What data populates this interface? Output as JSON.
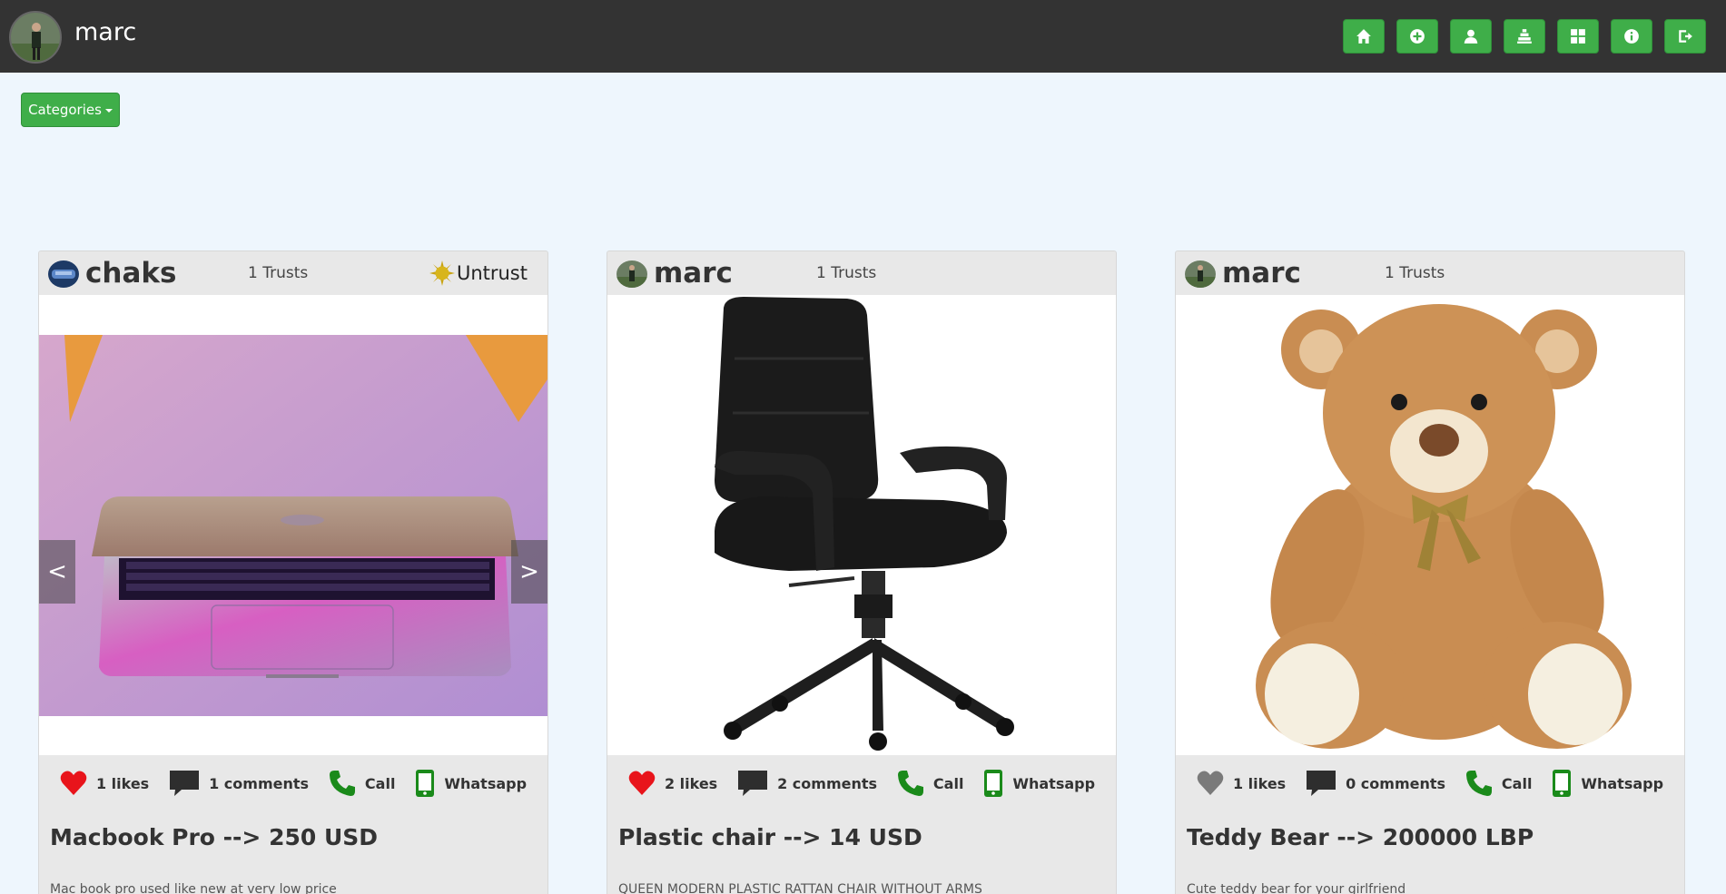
{
  "navbar": {
    "username": "marc",
    "buttons": [
      "home-icon",
      "plus-circle-icon",
      "user-icon",
      "tower-icon",
      "grid-icon",
      "info-icon",
      "logout-icon"
    ],
    "button_color": "#3fae49"
  },
  "categories": {
    "label": "Categories"
  },
  "cards": [
    {
      "owner": "chaks",
      "trusts": "1 Trusts",
      "trust_action": "Untrust",
      "likes": "1 likes",
      "comments": "1 comments",
      "call": "Call",
      "whatsapp": "Whatsapp",
      "liked": true,
      "title": "Macbook Pro --> 250 USD",
      "description": "Mac book pro used like new at very low price",
      "prev": "<",
      "next": ">"
    },
    {
      "owner": "marc",
      "trusts": "1 Trusts",
      "likes": "2 likes",
      "comments": "2 comments",
      "call": "Call",
      "whatsapp": "Whatsapp",
      "liked": true,
      "title": "Plastic chair --> 14 USD",
      "description": "QUEEN MODERN PLASTIC RATTAN CHAIR WITHOUT ARMS"
    },
    {
      "owner": "marc",
      "trusts": "1 Trusts",
      "likes": "1 likes",
      "comments": "0 comments",
      "call": "Call",
      "whatsapp": "Whatsapp",
      "liked": false,
      "title": "Teddy Bear --> 200000 LBP",
      "description": "Cute teddy bear for your girlfriend"
    }
  ],
  "colors": {
    "heart_liked": "#e8141b",
    "heart_unliked": "#7a7a7a",
    "phone": "#1a8a1a",
    "background": "#eef6fd",
    "navbar": "#333333"
  }
}
